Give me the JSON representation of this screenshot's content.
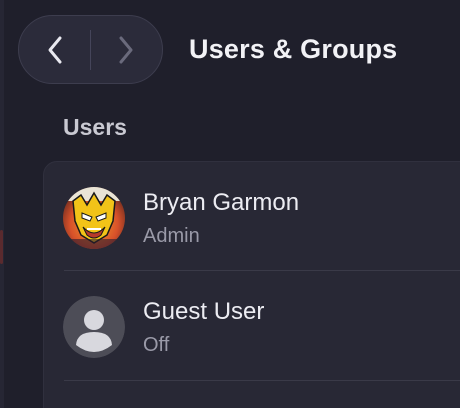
{
  "header": {
    "title": "Users & Groups",
    "back_icon": "chevron-left-icon",
    "forward_icon": "chevron-right-icon"
  },
  "users_section": {
    "heading": "Users",
    "users": [
      {
        "name": "Bryan Garmon",
        "role": "Admin",
        "avatar": "wolverine-comic-avatar"
      },
      {
        "name": "Guest User",
        "role": "Off",
        "avatar": "generic-person-icon"
      }
    ]
  },
  "colors": {
    "background": "#1f1f2b",
    "card": "#282835",
    "text_primary": "#ececf2",
    "text_secondary": "#9a9aa8",
    "avatar_yellow": "#f2c318",
    "avatar_red": "#c8402a"
  }
}
